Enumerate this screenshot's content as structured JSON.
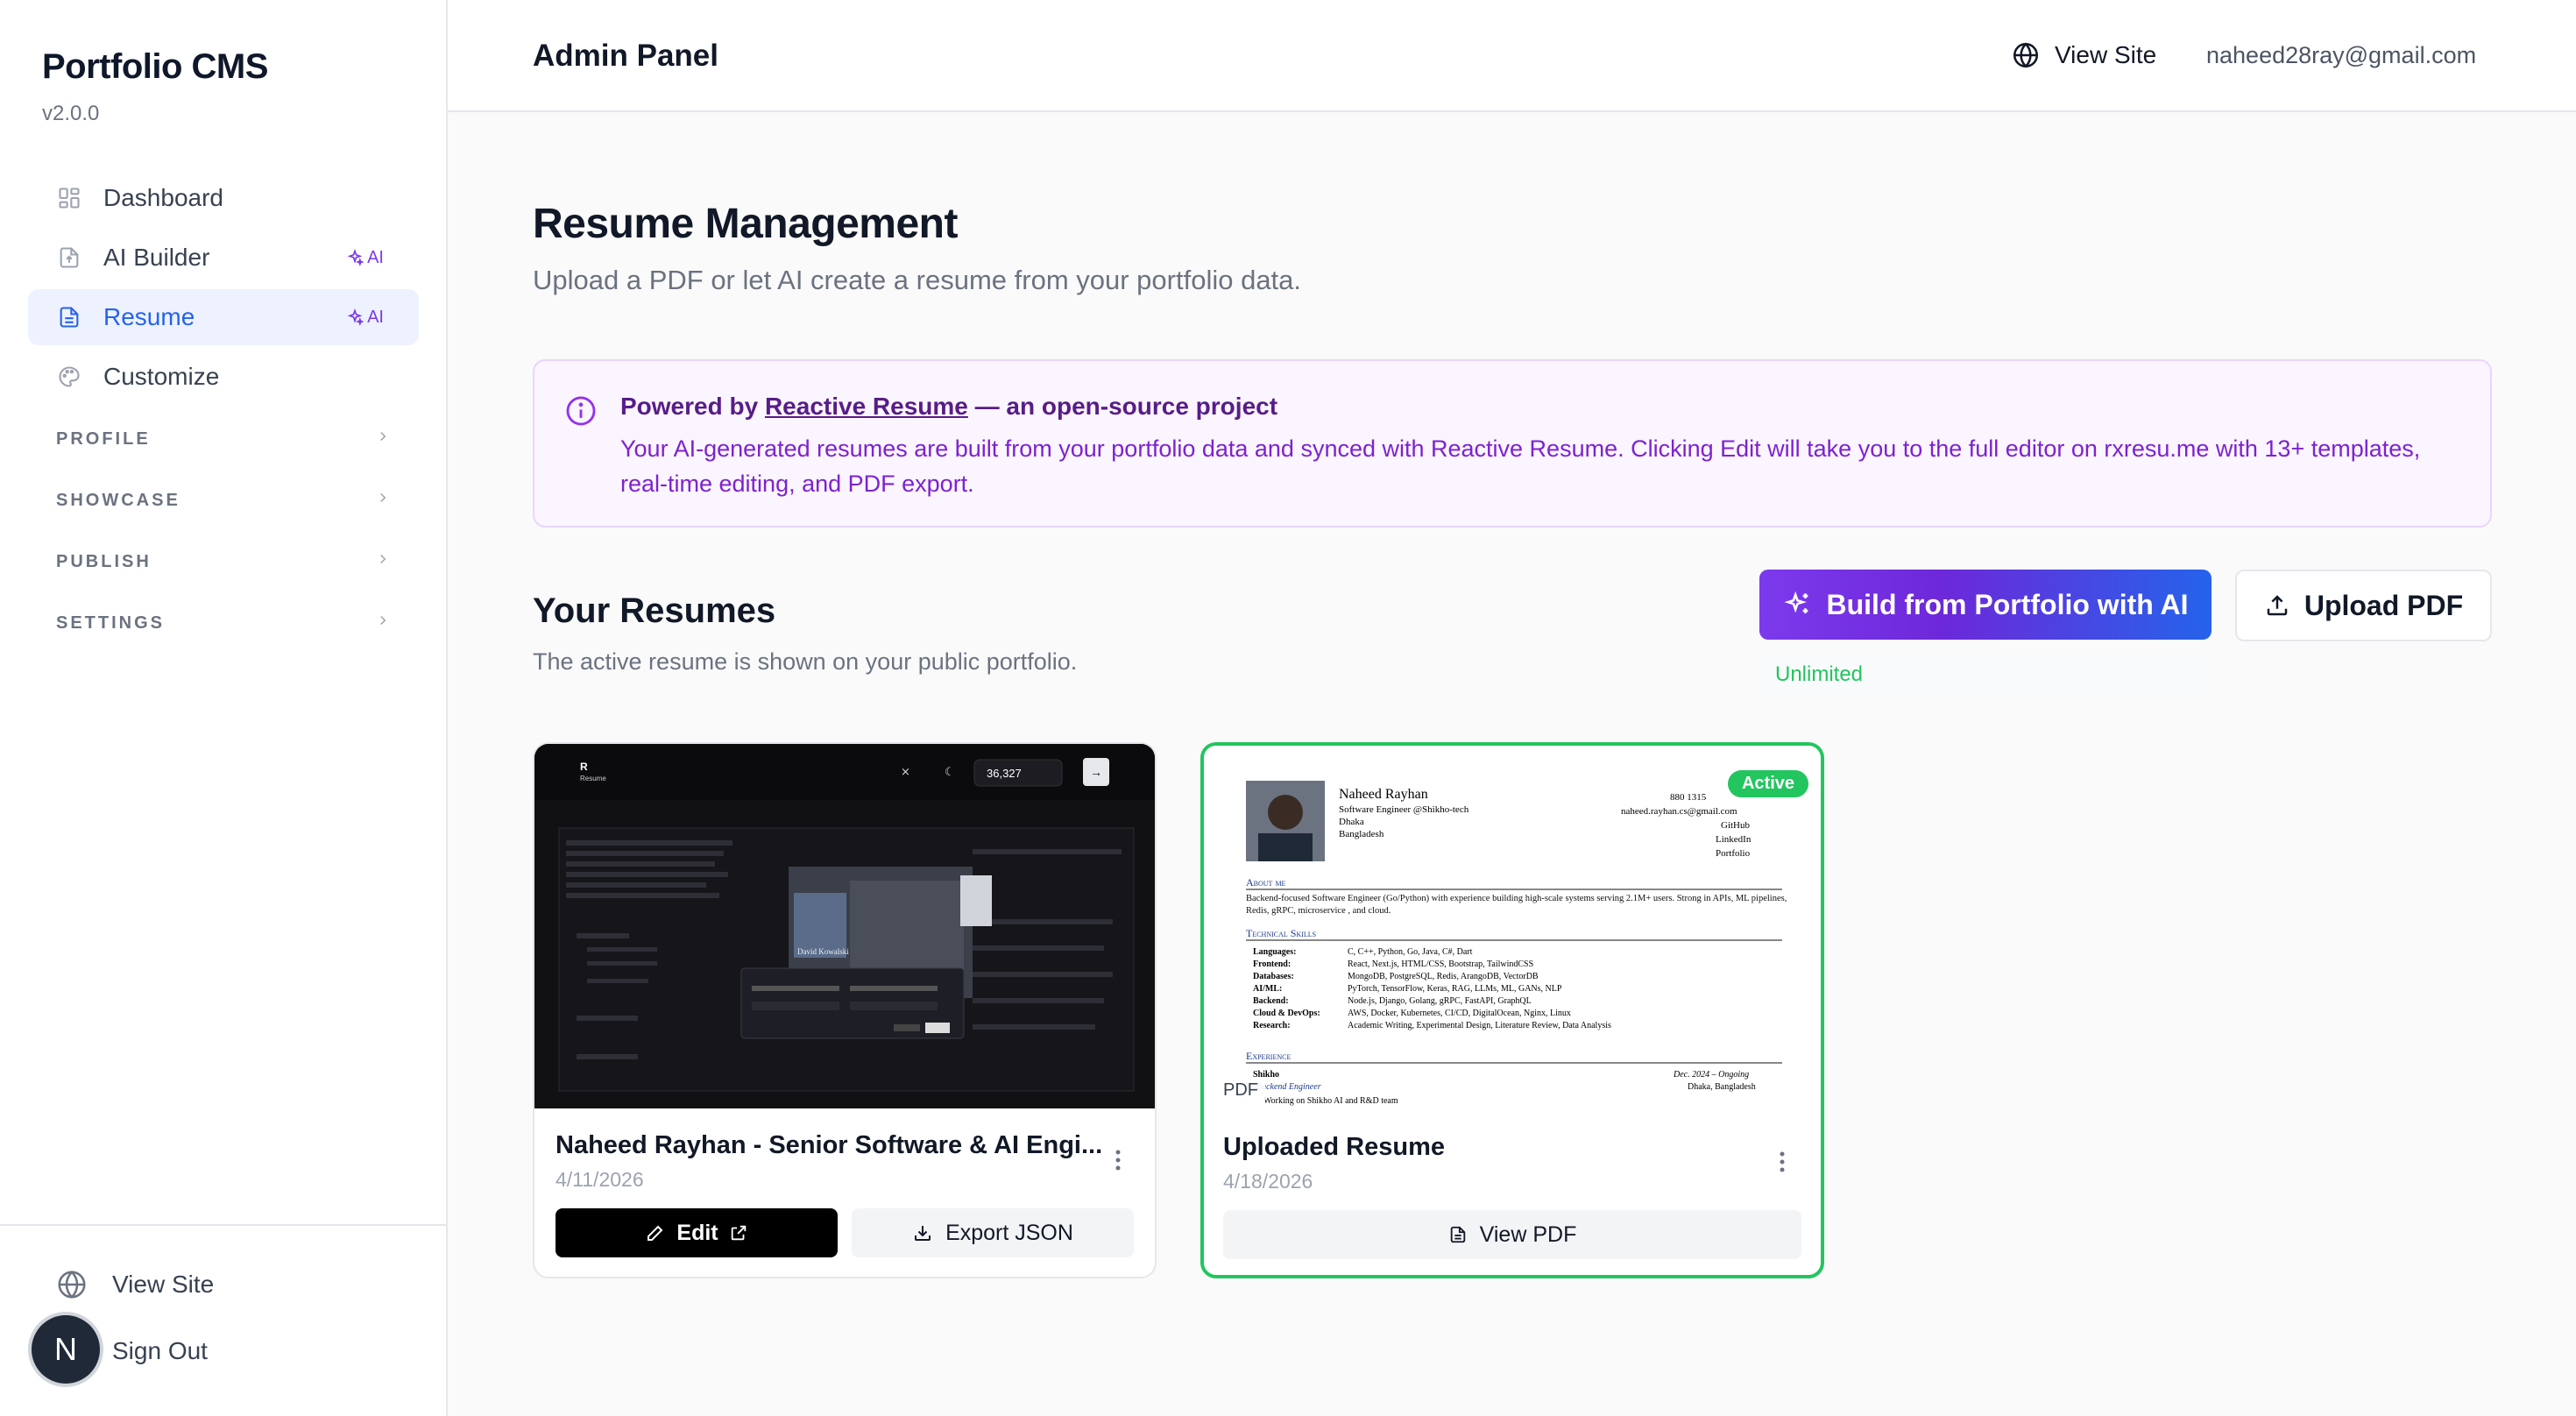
{
  "sidebar": {
    "brand": "Portfolio CMS",
    "version": "v2.0.0",
    "items": [
      {
        "label": "Dashboard",
        "icon": "grid-icon"
      },
      {
        "label": "AI Builder",
        "icon": "file-upload-icon",
        "badge": "AI"
      },
      {
        "label": "Resume",
        "icon": "document-icon",
        "badge": "AI",
        "active": true
      },
      {
        "label": "Customize",
        "icon": "palette-icon"
      }
    ],
    "sections": [
      "PROFILE",
      "SHOWCASE",
      "PUBLISH",
      "SETTINGS"
    ],
    "footer": {
      "view_site": "View Site",
      "sign_out": "Sign Out",
      "avatar_letter": "N"
    }
  },
  "header": {
    "title": "Admin Panel",
    "view_site": "View Site",
    "email": "naheed28ray@gmail.com"
  },
  "main": {
    "title": "Resume Management",
    "subtitle": "Upload a PDF or let AI create a resume from your portfolio data.",
    "info": {
      "prefix": "Powered by",
      "link": "Reactive Resume",
      "suffix": "— an open-source project",
      "body": "Your AI-generated resumes are built from your portfolio data and synced with Reactive Resume. Clicking Edit will take you to the full editor on rxresu.me with 13+ templates, real-time editing, and PDF export."
    },
    "resumes_title": "Your Resumes",
    "resumes_subtitle": "The active resume is shown on your public portfolio.",
    "build_button": "Build from Portfolio with AI",
    "unlimited": "Unlimited",
    "upload_button": "Upload PDF"
  },
  "cards": [
    {
      "title": "Naheed Rayhan - Senior Software & AI Engi...",
      "date": "4/11/2026",
      "edit_label": "Edit",
      "export_label": "Export JSON",
      "preview": {
        "stars": "36,327",
        "name": "David Kowalski"
      }
    },
    {
      "title": "Uploaded Resume",
      "date": "4/18/2026",
      "view_label": "View PDF",
      "badge": "Active",
      "pdf_tag": "PDF",
      "doc": {
        "name": "Naheed Rayhan",
        "role": "Software Engineer @Shikho-tech",
        "city": "Dhaka",
        "country": "Bangladesh",
        "phone": "880 1315",
        "email": "naheed.rayhan.cs@gmail.com",
        "links": [
          "GitHub",
          "LinkedIn",
          "Portfolio"
        ],
        "about_h": "About me",
        "about": "Backend-focused Software Engineer (Go/Python) with experience building high-scale systems serving 2.1M+ users. Strong in APIs, ML pipelines, Redis, gRPC, microservice , and cloud.",
        "skills_h": "Technical Skills",
        "skills": [
          [
            "Languages:",
            "C, C++, Python, Go, Java, C#, Dart"
          ],
          [
            "Frontend:",
            "React, Next.js, HTML/CSS, Bootstrap, TailwindCSS"
          ],
          [
            "Databases:",
            "MongoDB, PostgreSQL, Redis, ArangoDB, VectorDB"
          ],
          [
            "AI/ML:",
            "PyTorch, TensorFlow, Keras, RAG, LLMs, ML, GANs, NLP"
          ],
          [
            "Backend:",
            "Node.js, Django, Golang, gRPC, FastAPI, GraphQL"
          ],
          [
            "Cloud & DevOps:",
            "AWS, Docker, Kubernetes, CI/CD, DigitalOcean, Nginx, Linux"
          ],
          [
            "Research:",
            "Academic Writing, Experimental Design, Literature Review, Data Analysis"
          ]
        ],
        "exp_h": "Experience",
        "exp_org": "Shikho",
        "exp_date": "Dec. 2024 – Ongoing",
        "exp_role": "Backend Engineer",
        "exp_loc": "Dhaka, Bangladesh",
        "exp_line": "Working on Shikho AI and R&D team"
      }
    }
  ],
  "colors": {
    "accent": "#2563eb",
    "ai": "#7c3aed",
    "active": "#22c55e"
  }
}
